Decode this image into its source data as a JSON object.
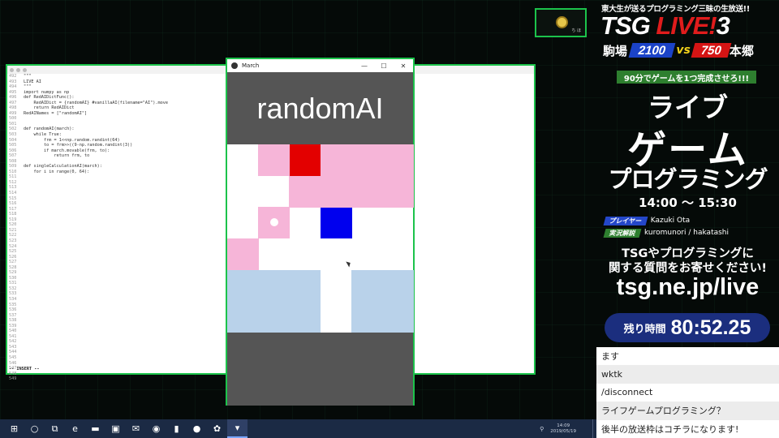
{
  "editor": {
    "lines": [
      {
        "n": "492",
        "code": "\"\"\""
      },
      {
        "n": "493",
        "code": "LIVE AI"
      },
      {
        "n": "494",
        "code": "\"\"\""
      },
      {
        "n": "495",
        "code": "import numpy as np"
      },
      {
        "n": "496",
        "code": "def RedAIDictFunc():"
      },
      {
        "n": "497",
        "code": "    RedAIDict = {randomAI} #vanillaAI(filename=\"AI\").move"
      },
      {
        "n": "498",
        "code": "    return RedAIDict"
      },
      {
        "n": "499",
        "code": "RedAINames = [\"randomAI\"]"
      },
      {
        "n": "500",
        "code": ""
      },
      {
        "n": "501",
        "code": ""
      },
      {
        "n": "502",
        "code": "def randomAI(march):"
      },
      {
        "n": "503",
        "code": "    while True:"
      },
      {
        "n": "504",
        "code": "        frm = 1<<np.random.randint(64)"
      },
      {
        "n": "505",
        "code": "        to = frm>>((9-np.random.randint(3))"
      },
      {
        "n": "506",
        "code": "        if march.movable(frm, to):"
      },
      {
        "n": "507",
        "code": "            return frm, to"
      },
      {
        "n": "508",
        "code": ""
      },
      {
        "n": "509",
        "code": "def singleCalculationAI(march):"
      },
      {
        "n": "510",
        "code": "    for i in range(0, 64):"
      },
      {
        "n": "511",
        "code": ""
      },
      {
        "n": "512",
        "code": ""
      },
      {
        "n": "513",
        "code": ""
      },
      {
        "n": "514",
        "code": ""
      },
      {
        "n": "515",
        "code": ""
      },
      {
        "n": "516",
        "code": ""
      },
      {
        "n": "517",
        "code": ""
      },
      {
        "n": "518",
        "code": ""
      },
      {
        "n": "519",
        "code": ""
      },
      {
        "n": "520",
        "code": ""
      },
      {
        "n": "521",
        "code": ""
      },
      {
        "n": "522",
        "code": ""
      },
      {
        "n": "523",
        "code": ""
      },
      {
        "n": "524",
        "code": ""
      },
      {
        "n": "525",
        "code": ""
      },
      {
        "n": "526",
        "code": ""
      },
      {
        "n": "527",
        "code": ""
      },
      {
        "n": "528",
        "code": ""
      },
      {
        "n": "529",
        "code": ""
      },
      {
        "n": "530",
        "code": ""
      },
      {
        "n": "531",
        "code": ""
      },
      {
        "n": "532",
        "code": ""
      },
      {
        "n": "533",
        "code": ""
      },
      {
        "n": "534",
        "code": ""
      },
      {
        "n": "535",
        "code": ""
      },
      {
        "n": "536",
        "code": ""
      },
      {
        "n": "537",
        "code": ""
      },
      {
        "n": "538",
        "code": ""
      },
      {
        "n": "539",
        "code": ""
      },
      {
        "n": "540",
        "code": ""
      },
      {
        "n": "541",
        "code": ""
      },
      {
        "n": "542",
        "code": ""
      },
      {
        "n": "543",
        "code": ""
      },
      {
        "n": "544",
        "code": ""
      },
      {
        "n": "545",
        "code": ""
      },
      {
        "n": "546",
        "code": ""
      },
      {
        "n": "547",
        "code": ""
      },
      {
        "n": "548",
        "code": ""
      },
      {
        "n": "549",
        "code": ""
      }
    ],
    "mode": "-- INSERT --"
  },
  "game": {
    "window_title": "March",
    "minimize": "—",
    "maximize": "☐",
    "close": "✕",
    "header": "randomAI",
    "board": [
      [
        "w",
        "p",
        "r",
        "p",
        "p",
        "p"
      ],
      [
        "w",
        "w",
        "p",
        "p",
        "p",
        "p"
      ],
      [
        "w",
        "p",
        "b",
        "B",
        "w",
        "w"
      ],
      [
        "p",
        "w",
        "w",
        "w",
        "w",
        "w"
      ],
      [
        "l",
        "l",
        "l",
        "w",
        "l",
        "l"
      ],
      [
        "l",
        "l",
        "l",
        "w",
        "l",
        "l"
      ]
    ],
    "colors": {
      "pink": "#f6b5d8",
      "light_blue": "#b9d2ea",
      "red": "#e30000",
      "blue": "#0000ee"
    }
  },
  "overlay": {
    "tagline": "東大生が送るプログラミング三昧の生放送!!",
    "brand_tsg": "TSG ",
    "brand_live": "LIVE!",
    "brand_num": "3",
    "left_campus": "駒場",
    "left_score": "2100",
    "vs": "vs",
    "right_score": "750",
    "right_campus": "本郷",
    "subtitle": "90分でゲームを1つ完成させろ!!!",
    "title_line1": "ライブ",
    "title_line2": "ゲーム",
    "title_line3": "プログラミング",
    "time_range": "14:00 〜 15:30",
    "player_label": "プレイヤー",
    "player_name": "Kazuki Ota",
    "commentary_label": "実況解説",
    "commentary_names": "kuromunori / hakatashi",
    "question_line1": "TSGやプログラミングに",
    "question_line2": "関する質問をお寄せください!",
    "url": "tsg.ne.jp/live",
    "timer_label": "残り時間",
    "timer_value": "80:52.25",
    "cam_text": "ち ほ"
  },
  "chat": [
    {
      "text": "ます"
    },
    {
      "text": "wktk"
    },
    {
      "text": "/disconnect"
    },
    {
      "text": "ライフゲームプログラミング？"
    },
    {
      "text": "後半の放送枠はコチラになります!"
    }
  ],
  "taskbar": {
    "clock_time": "14:09",
    "clock_date": "2019/05/19",
    "icons": [
      {
        "name": "windows-start-icon",
        "glyph": "⊞"
      },
      {
        "name": "search-icon",
        "glyph": "○"
      },
      {
        "name": "task-view-icon",
        "glyph": "⧉"
      },
      {
        "name": "edge-icon",
        "glyph": "e"
      },
      {
        "name": "file-explorer-icon",
        "glyph": "▬"
      },
      {
        "name": "store-icon",
        "glyph": "▣"
      },
      {
        "name": "mail-icon",
        "glyph": "✉"
      },
      {
        "name": "chrome-icon",
        "glyph": "◉"
      },
      {
        "name": "terminal-icon",
        "glyph": "▮"
      },
      {
        "name": "media-icon",
        "glyph": "●"
      },
      {
        "name": "app-icon",
        "glyph": "✿"
      },
      {
        "name": "march-app-icon",
        "glyph": "▾"
      }
    ]
  }
}
